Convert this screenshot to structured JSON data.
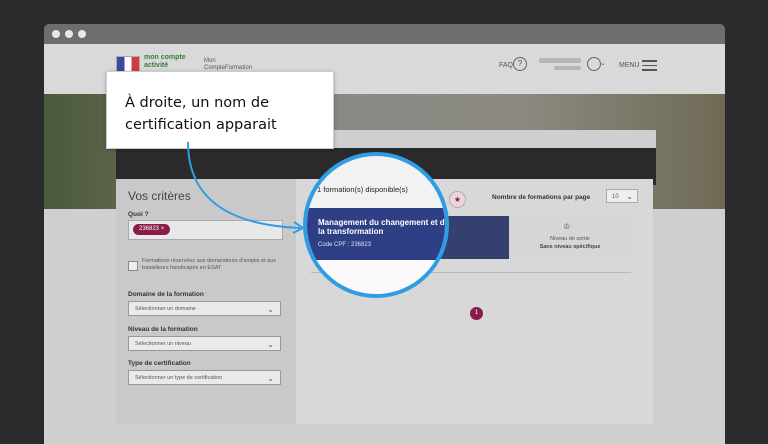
{
  "header": {
    "faq": "FAQ",
    "faq_icon": "?",
    "menu": "MENU",
    "logo_mcf_1": "mon compte",
    "logo_mcf_2": "activité",
    "logo_cf_1": "Mon",
    "logo_cf_2": "CompteFormation"
  },
  "callout": {
    "text": "À droite, un nom de certification apparait"
  },
  "criteria": {
    "title": "Vos critères",
    "quoi_label": "Quoi ?",
    "tag": "236823",
    "tag_remove": "×",
    "checkbox_label": "Formations réservées aux demandeurs d'emploi et aux travailleurs handicapés en ESAT",
    "domaine_label": "Domaine de la formation",
    "domaine_placeholder": "Sélectionner un domaine",
    "niveau_label": "Niveau de la formation",
    "niveau_placeholder": "Sélectionner un niveau",
    "type_label": "Type de certification",
    "type_placeholder": "Sélectionner un type de certification"
  },
  "results": {
    "count_text": "1 formation(s) disponible(s)",
    "per_page_label": "Nombre de formations par page",
    "per_page_value": "10",
    "card": {
      "title": "Management du changement et de la transformation",
      "code": "Code CPF : 236823",
      "level_label": "Niveau de sortie",
      "level_value": "Sans niveau spécifique"
    },
    "page": "1"
  },
  "icons": {
    "chevron": "⌄",
    "star": "★",
    "graduation": "♔"
  },
  "colors": {
    "accent": "#8a1c4a",
    "card_blue": "#34406e",
    "lens_border": "#2f9de4"
  }
}
